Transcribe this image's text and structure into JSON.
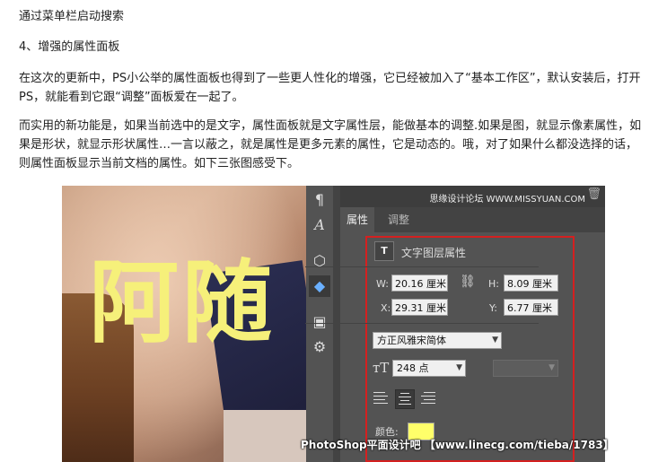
{
  "article": {
    "p1": "通过菜单栏启动搜索",
    "p2": "4、增强的属性面板",
    "p3": "在这次的更新中，PS小公举的属性面板也得到了一些更人性化的增强，它已经被加入了“基本工作区”，默认安装后，打开PS，就能看到它跟“调整”面板爱在一起了。",
    "p4": "而实用的新功能是，如果当前选中的是文字，属性面板就是文字属性层，能做基本的调整.如果是图，就显示像素属性，如果是形状，就显示形状属性…一言以蔽之，就是属性是更多元素的属性，它是动态的。哦，对了如果什么都没选择的话，则属性面板显示当前文档的属性。如下三张图感受下。"
  },
  "photo": {
    "big_text": "阿随"
  },
  "panel": {
    "watermark": "思缘设计论坛 WWW.MISSYUAN.COM",
    "tabs": [
      "属性",
      "调整"
    ],
    "section_title": "文字图层属性",
    "section_icon": "T",
    "w_label": "W:",
    "w_value": "20.16 厘米",
    "h_label": "H:",
    "h_value": "8.09 厘米",
    "x_label": "X:",
    "x_value": "29.31 厘米",
    "y_label": "Y:",
    "y_value": "6.77 厘米",
    "font_family": "方正风雅宋简体",
    "font_size": "248 点",
    "color_label": "颜色:",
    "color_value": "#ffff6a"
  },
  "footer": "PhotoShop平面设计吧 【www.linecg.com/tieba/1783】"
}
